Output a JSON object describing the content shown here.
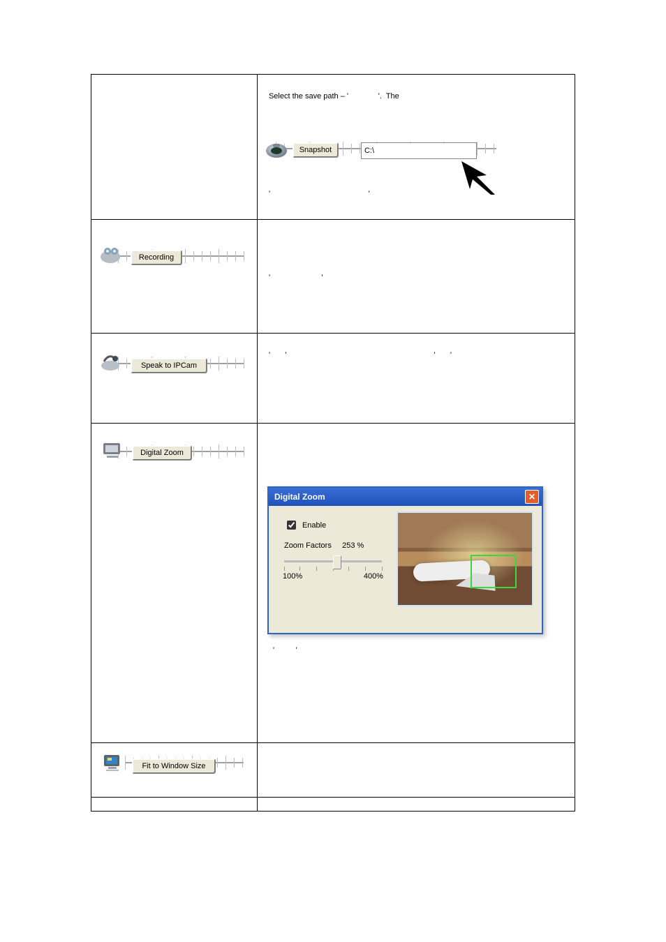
{
  "row1": {
    "snapshot_btn": "Snapshot",
    "path_text": "C:\\",
    "desc_top": "Select the save path – '              '.  The",
    "desc_bottom": "'                                              '"
  },
  "row2": {
    "btn": "Recording",
    "desc": "'                        '"
  },
  "row3": {
    "btn": "Speak to IPCam",
    "desc": "'       '                                                                     '       '"
  },
  "row4": {
    "btn": "Digital Zoom",
    "dialog": {
      "title": "Digital Zoom",
      "enable": "Enable",
      "zoom_label": "Zoom Factors",
      "zoom_value": "253 %",
      "min": "100%",
      "max": "400%"
    },
    "desc_after": "'          '"
  },
  "row5": {
    "btn": "Fit to Window Size"
  }
}
